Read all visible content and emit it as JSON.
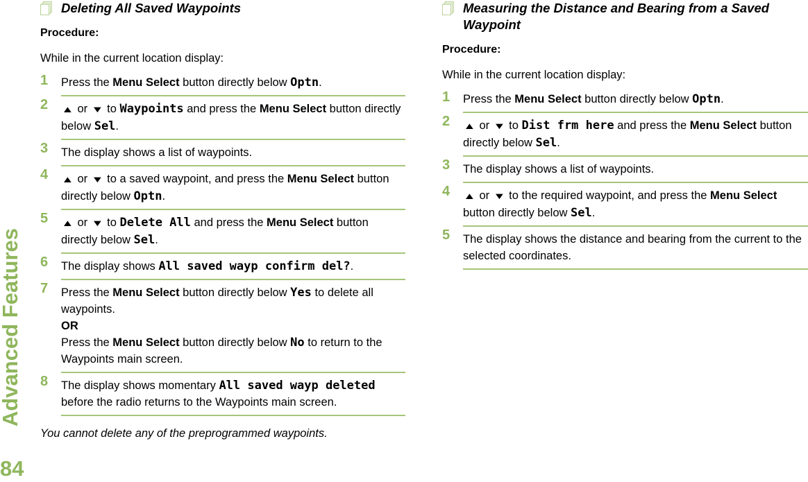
{
  "sidebar": {
    "chapter": "Advanced Features",
    "page_number": "84"
  },
  "colors": {
    "accent": "#8fb65c",
    "rule": "#a6c47a"
  },
  "left": {
    "title": "Deleting All Saved Waypoints",
    "procedure_label": "Procedure:",
    "intro": "While in the current location display:",
    "steps": [
      {
        "n": "1",
        "parts": [
          "Press the ",
          {
            "b": "Menu Select"
          },
          " button directly below ",
          {
            "lcd": "Optn"
          },
          "."
        ]
      },
      {
        "n": "2",
        "parts": [
          {
            "up": "▲"
          },
          " or ",
          {
            "down": "▼"
          },
          " to ",
          {
            "lcd": "Waypoints"
          },
          " and press the ",
          {
            "b": "Menu Select"
          },
          " button directly below ",
          {
            "lcd": "Sel"
          },
          "."
        ]
      },
      {
        "n": "3",
        "parts": [
          "The display shows a list of waypoints."
        ]
      },
      {
        "n": "4",
        "parts": [
          {
            "up": "▲"
          },
          " or ",
          {
            "down": "▼"
          },
          " to a saved waypoint, and press the ",
          {
            "b": "Menu Select"
          },
          " button directly below ",
          {
            "lcd": "Optn"
          },
          "."
        ]
      },
      {
        "n": "5",
        "parts": [
          {
            "up": "▲"
          },
          " or ",
          {
            "down": "▼"
          },
          " to ",
          {
            "lcd": "Delete All"
          },
          " and press the ",
          {
            "b": "Menu Select"
          },
          " button directly below ",
          {
            "lcd": "Sel"
          },
          "."
        ]
      },
      {
        "n": "6",
        "parts": [
          "The display shows ",
          {
            "lcd": "All saved wayp confirm del?"
          },
          "."
        ]
      },
      {
        "n": "7",
        "parts": [
          "Press the ",
          {
            "b": "Menu Select"
          },
          " button directly below ",
          {
            "lcd": "Yes"
          },
          " to delete all waypoints.",
          {
            "br": true
          },
          {
            "b": "OR"
          },
          {
            "br": true
          },
          "Press the ",
          {
            "b": "Menu Select"
          },
          " button directly below ",
          {
            "lcd": "No"
          },
          " to return to the Waypoints main screen."
        ]
      },
      {
        "n": "8",
        "parts": [
          "The display shows  momentary ",
          {
            "lcd": "All saved wayp deleted"
          },
          " before the radio returns to the Waypoints main screen."
        ]
      }
    ],
    "note": "You cannot delete any of the preprogrammed waypoints."
  },
  "right": {
    "title": "Measuring the Distance and Bearing from a Saved Waypoint",
    "procedure_label": "Procedure:",
    "intro": "While in the current location display:",
    "steps": [
      {
        "n": "1",
        "parts": [
          "Press the ",
          {
            "b": "Menu Select"
          },
          " button directly below ",
          {
            "lcd": "Optn"
          },
          "."
        ]
      },
      {
        "n": "2",
        "parts": [
          {
            "up": "▲"
          },
          " or ",
          {
            "down": "▼"
          },
          " to ",
          {
            "lcd": "Dist frm here"
          },
          " and press the ",
          {
            "b": "Menu Select"
          },
          " button directly below ",
          {
            "lcd": "Sel"
          },
          "."
        ]
      },
      {
        "n": "3",
        "parts": [
          "The display shows a list of waypoints."
        ]
      },
      {
        "n": "4",
        "parts": [
          {
            "up": "▲"
          },
          " or ",
          {
            "down": "▼"
          },
          " to the required waypoint, and press the ",
          {
            "b": "Menu Select"
          },
          " button directly below ",
          {
            "lcd": "Sel"
          },
          "."
        ]
      },
      {
        "n": "5",
        "parts": [
          "The display shows the distance and bearing from the current to the selected coordinates."
        ]
      }
    ]
  }
}
